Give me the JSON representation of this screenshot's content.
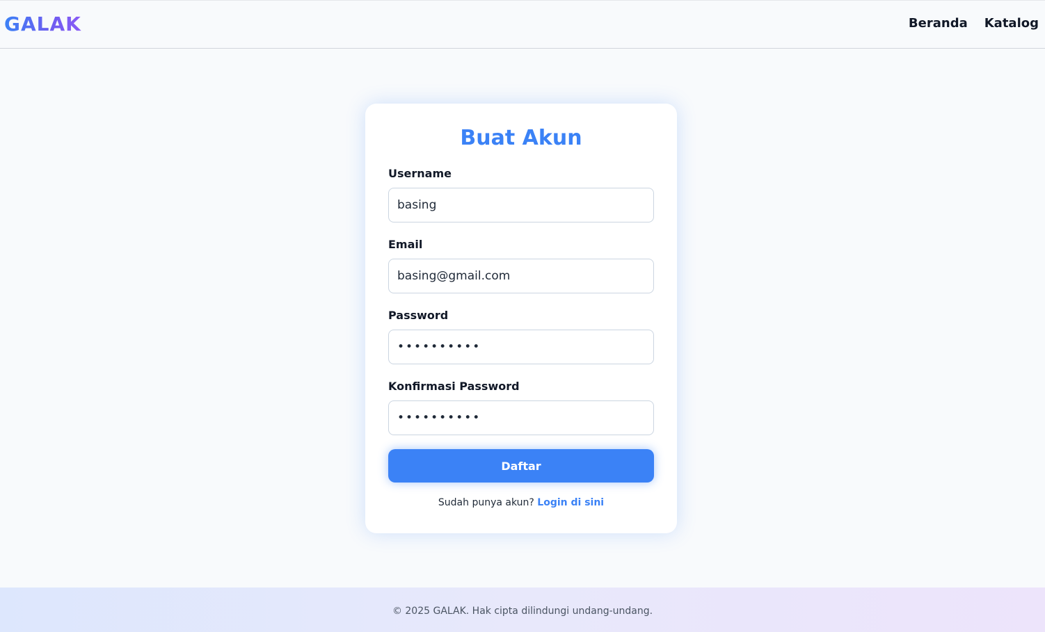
{
  "brand": {
    "logo": "GALAK"
  },
  "nav": {
    "items": [
      "Beranda",
      "Katalog"
    ]
  },
  "form": {
    "title": "Buat Akun",
    "username": {
      "label": "Username",
      "value": "basing"
    },
    "email": {
      "label": "Email",
      "value": "basing@gmail.com"
    },
    "password": {
      "label": "Password",
      "value": "••••••••••"
    },
    "confirm_password": {
      "label": "Konfirmasi Password",
      "value": "••••••••••"
    },
    "submit_label": "Daftar",
    "login_prompt": "Sudah punya akun?",
    "login_link": "Login di sini"
  },
  "footer": {
    "text": "© 2025 GALAK. Hak cipta dilindungi undang-undang."
  },
  "colors": {
    "accent": "#3b82f6",
    "logo_gradient_start": "#3b82f6",
    "logo_gradient_end": "#8b5cf6",
    "page_background": "#f8fafc"
  }
}
